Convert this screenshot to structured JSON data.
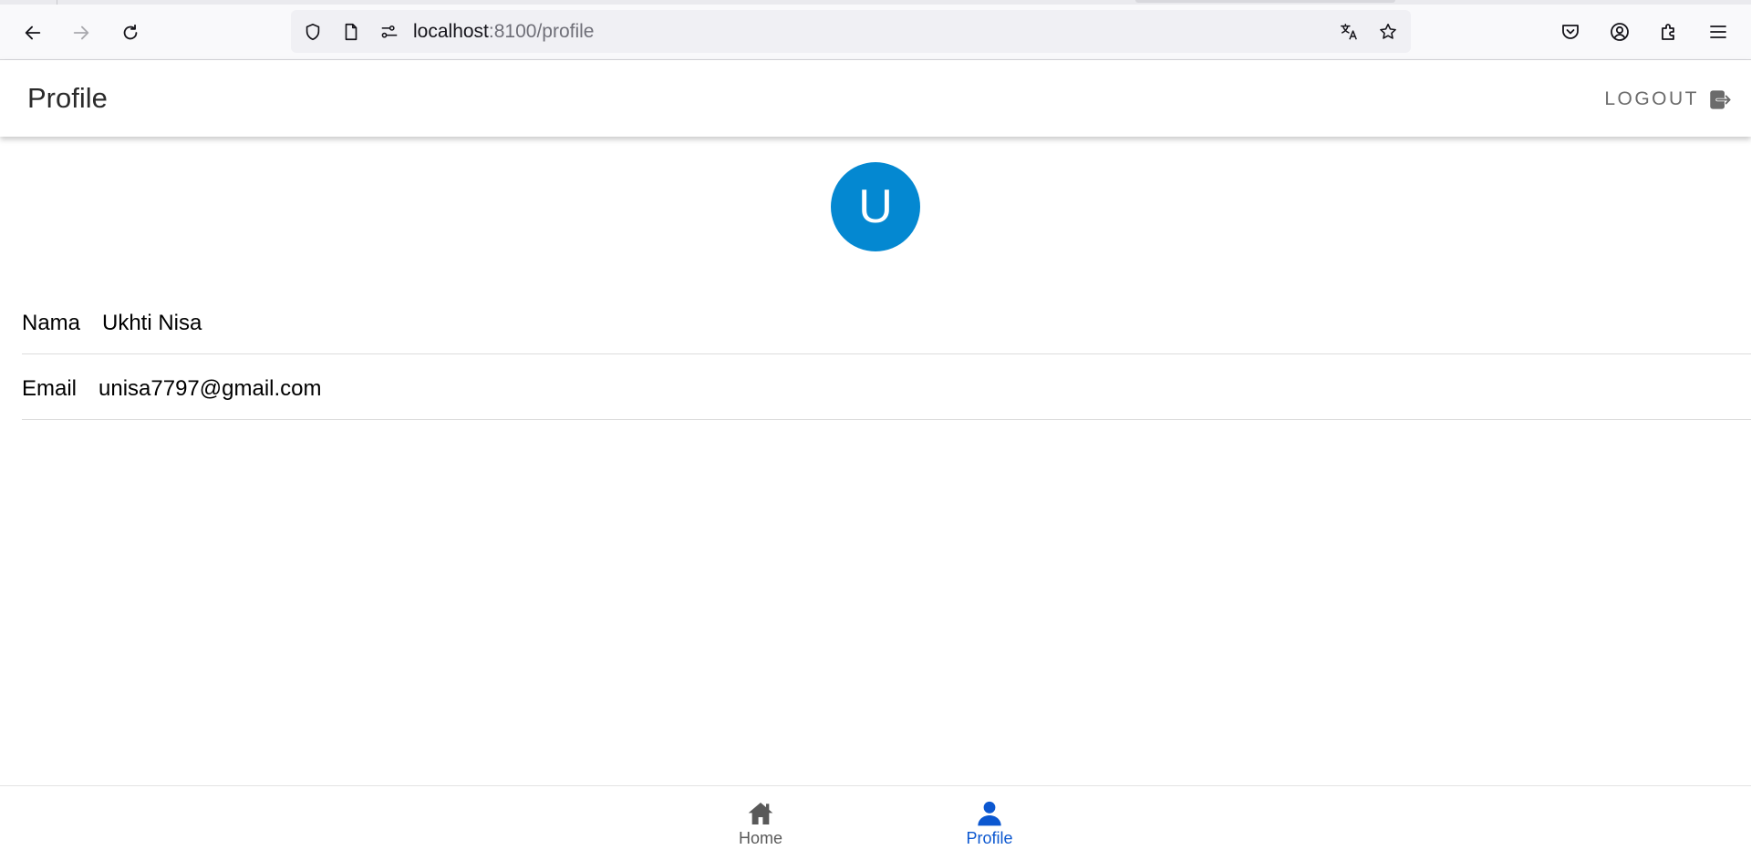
{
  "browser": {
    "url_host": "localhost",
    "url_rest": ":8100/profile",
    "icons": [
      "back-arrow-icon",
      "forward-arrow-icon",
      "reload-icon",
      "shield-icon",
      "page-icon",
      "permissions-icon",
      "translate-icon",
      "bookmark-star-icon",
      "pocket-icon",
      "account-icon",
      "extensions-icon",
      "menu-icon"
    ]
  },
  "header": {
    "title": "Profile",
    "logout_label": "LOGOUT"
  },
  "profile": {
    "avatar_initial": "U",
    "avatar_color": "#0488d1",
    "fields": [
      {
        "label": "Nama",
        "value": "Ukhti Nisa"
      },
      {
        "label": "Email",
        "value": "unisa7797@gmail.com"
      }
    ]
  },
  "tabs": [
    {
      "label": "Home",
      "icon": "home-icon",
      "active": false
    },
    {
      "label": "Profile",
      "icon": "person-icon",
      "active": true
    }
  ],
  "colors": {
    "active_tab": "#0b57d0",
    "inactive_tab": "#595959"
  }
}
